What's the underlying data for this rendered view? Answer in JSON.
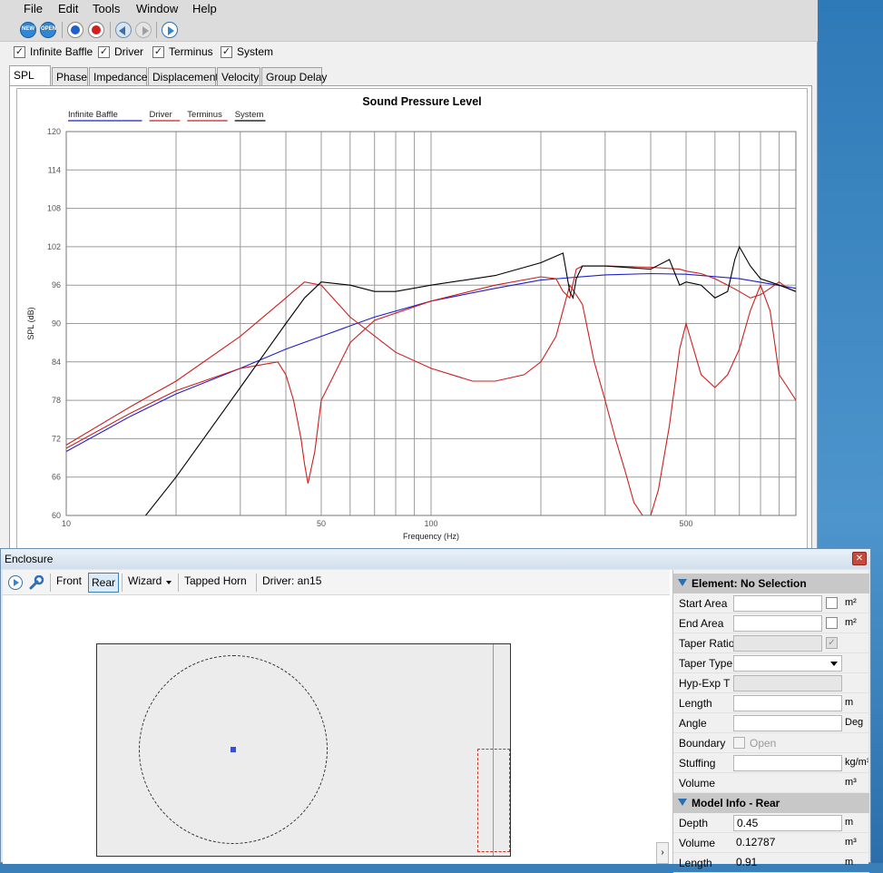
{
  "menu": [
    "File",
    "Edit",
    "Tools",
    "Window",
    "Help"
  ],
  "toolbar": {
    "new_label": "NEW",
    "open_label": "OPEN"
  },
  "checks": [
    {
      "label": "Infinite Baffle",
      "checked": true
    },
    {
      "label": "Driver",
      "checked": true
    },
    {
      "label": "Terminus",
      "checked": true
    },
    {
      "label": "System",
      "checked": true
    }
  ],
  "tabs": [
    "SPL",
    "Phase",
    "Impedance",
    "Displacement",
    "Velocity",
    "Group Delay"
  ],
  "active_tab": "SPL",
  "chart_data": {
    "type": "line",
    "title": "Sound Pressure Level",
    "xlabel": "Frequency (Hz)",
    "ylabel": "SPL (dB)",
    "x_scale": "log",
    "xlim": [
      10,
      1000
    ],
    "ylim": [
      60,
      120
    ],
    "yticks": [
      60,
      66,
      72,
      78,
      84,
      90,
      96,
      102,
      108,
      114,
      120
    ],
    "xtick_labels": [
      {
        "value": 10,
        "label": "10"
      },
      {
        "value": 50,
        "label": "50"
      },
      {
        "value": 100,
        "label": "100"
      },
      {
        "value": 500,
        "label": "500"
      }
    ],
    "grid": true,
    "legend_position": "top-left",
    "series": [
      {
        "name": "Infinite Baffle",
        "color": "#1f1fcc",
        "x": [
          10,
          15,
          20,
          30,
          40,
          50,
          70,
          100,
          150,
          200,
          300,
          400,
          500,
          700,
          1000
        ],
        "y": [
          70,
          75.5,
          79,
          83,
          86,
          88,
          91,
          93.5,
          95.5,
          96.8,
          97.6,
          97.8,
          97.7,
          97,
          95.5
        ]
      },
      {
        "name": "Driver",
        "color": "#cc1f1f",
        "x": [
          10,
          15,
          20,
          30,
          38,
          40,
          42,
          44,
          45,
          46,
          48,
          50,
          60,
          70,
          100,
          150,
          200,
          220,
          230,
          240,
          250,
          260,
          300,
          400,
          480,
          500,
          550,
          600,
          650,
          700,
          750,
          800,
          850,
          900,
          950,
          1000
        ],
        "y": [
          70.5,
          76,
          79.5,
          83,
          84,
          82,
          78,
          72,
          68,
          65,
          70,
          78,
          87,
          90.5,
          93.5,
          96,
          97.3,
          97,
          95,
          94,
          98.5,
          99,
          99,
          98.8,
          98.5,
          98.2,
          97.8,
          97,
          96,
          95,
          94,
          94.5,
          95.5,
          96.5,
          95.5,
          95
        ]
      },
      {
        "name": "Terminus",
        "color": "#cc1f1f",
        "x": [
          10,
          15,
          20,
          30,
          40,
          45,
          50,
          60,
          80,
          100,
          130,
          150,
          180,
          200,
          220,
          240,
          260,
          280,
          300,
          320,
          340,
          360,
          380,
          400,
          420,
          450,
          480,
          500,
          550,
          600,
          650,
          700,
          750,
          800,
          850,
          900,
          950,
          1000
        ],
        "y": [
          71,
          77,
          81,
          88,
          94,
          96.5,
          96,
          91,
          85.5,
          83,
          81,
          81,
          82,
          84,
          88,
          96,
          93,
          84,
          78,
          72,
          67,
          62,
          60,
          60,
          64,
          74,
          86,
          90,
          82,
          80,
          82,
          86,
          92,
          96,
          92,
          82,
          80,
          78
        ]
      },
      {
        "name": "System",
        "color": "#000000",
        "x": [
          10,
          15,
          20,
          30,
          40,
          45,
          50,
          60,
          70,
          80,
          100,
          150,
          200,
          230,
          240,
          245,
          250,
          260,
          300,
          400,
          450,
          480,
          500,
          550,
          600,
          650,
          680,
          700,
          750,
          800,
          850,
          900,
          950,
          1000
        ],
        "y": [
          50,
          57,
          66,
          80,
          90,
          94,
          96.5,
          96,
          95,
          95,
          96,
          97.5,
          99.5,
          101,
          95,
          94,
          97,
          99,
          99,
          98.5,
          100,
          96,
          96.5,
          96,
          94,
          95,
          100,
          102,
          99,
          97,
          96.5,
          96,
          95.5,
          95
        ]
      }
    ]
  },
  "enclosure": {
    "title": "Enclosure",
    "toolbar": {
      "front_label": "Front",
      "rear_label": "Rear",
      "wizard_label": "Wizard",
      "type_label": "Tapped Horn",
      "driver_label": "Driver: an15"
    },
    "properties": {
      "element_header": "Element: No Selection",
      "rows": [
        {
          "label": "Start Area",
          "value": "",
          "unit": "m²",
          "kind": "input-check"
        },
        {
          "label": "End Area",
          "value": "",
          "unit": "m²",
          "kind": "input-check"
        },
        {
          "label": "Taper Ratio",
          "value": "",
          "unit": "",
          "kind": "disabled-check"
        },
        {
          "label": "Taper Type",
          "value": "",
          "unit": "",
          "kind": "select"
        },
        {
          "label": "Hyp-Exp T",
          "value": "",
          "unit": "",
          "kind": "disabled"
        },
        {
          "label": "Length",
          "value": "",
          "unit": "m",
          "kind": "input"
        },
        {
          "label": "Angle",
          "value": "",
          "unit": "Deg",
          "kind": "input"
        },
        {
          "label": "Boundary",
          "value": "Open",
          "unit": "",
          "kind": "open"
        },
        {
          "label": "Stuffing",
          "value": "",
          "unit": "kg/m³",
          "kind": "input"
        },
        {
          "label": "Volume",
          "value": "",
          "unit": "m³",
          "kind": "readonly"
        }
      ],
      "model_header": "Model Info - Rear",
      "model_rows": [
        {
          "label": "Depth",
          "value": "0.45",
          "unit": "m",
          "kind": "input"
        },
        {
          "label": "Volume",
          "value": "0.12787",
          "unit": "m³",
          "kind": "readonly"
        },
        {
          "label": "Length",
          "value": "0.91",
          "unit": "m",
          "kind": "readonly"
        }
      ]
    }
  }
}
